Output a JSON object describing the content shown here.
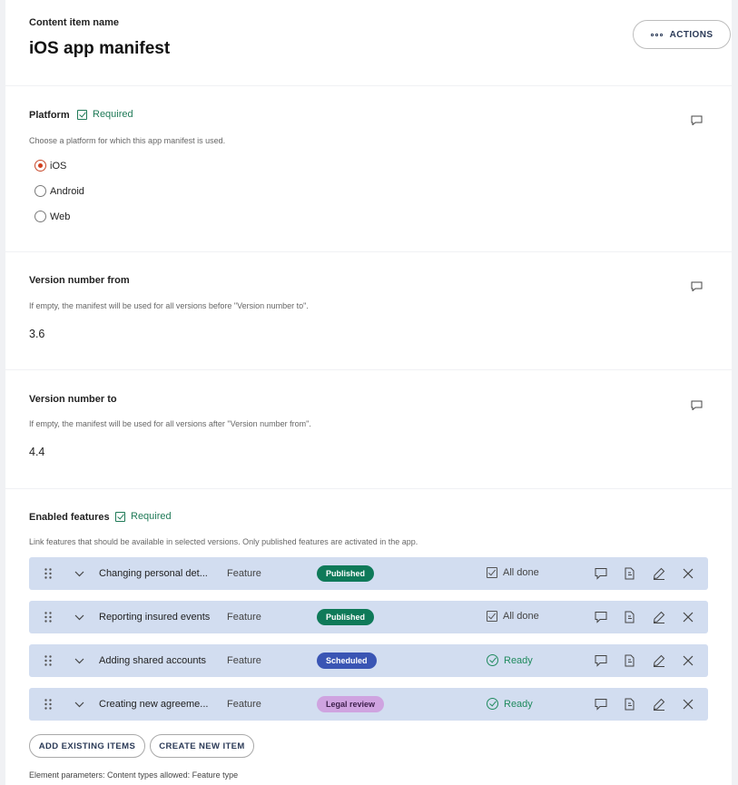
{
  "header": {
    "label": "Content item name",
    "title": "iOS app manifest",
    "actions_label": "ACTIONS"
  },
  "platform": {
    "label": "Platform",
    "required": "Required",
    "guidelines": "Choose a platform for which this app manifest is used.",
    "options": [
      {
        "label": "iOS",
        "selected": true
      },
      {
        "label": "Android",
        "selected": false
      },
      {
        "label": "Web",
        "selected": false
      }
    ]
  },
  "version_from": {
    "label": "Version number from",
    "guidelines": "If empty, the manifest will be used for all versions before \"Version number to\".",
    "value": "3.6"
  },
  "version_to": {
    "label": "Version number to",
    "guidelines": "If empty, the manifest will be used for all versions after \"Version number from\".",
    "value": "4.4"
  },
  "features": {
    "label": "Enabled features",
    "required": "Required",
    "guidelines": "Link features that should be available in selected versions. Only published features are activated in the app.",
    "items": [
      {
        "name": "Changing personal det...",
        "type": "Feature",
        "status": "Published",
        "status_color": "#0f7a59",
        "workflow": "All done",
        "workflow_kind": "done"
      },
      {
        "name": "Reporting insured events",
        "type": "Feature",
        "status": "Published",
        "status_color": "#0f7a59",
        "workflow": "All done",
        "workflow_kind": "done"
      },
      {
        "name": "Adding shared accounts",
        "type": "Feature",
        "status": "Scheduled",
        "status_color": "#3a55b4",
        "workflow": "Ready",
        "workflow_kind": "ready"
      },
      {
        "name": "Creating new agreeme...",
        "type": "Feature",
        "status": "Legal review",
        "status_color": "#cfa3e0",
        "workflow": "Ready",
        "workflow_kind": "ready"
      }
    ],
    "add_existing_label": "ADD EXISTING ITEMS",
    "create_new_label": "CREATE NEW ITEM",
    "parameters": "Element parameters: Content types allowed: Feature type"
  },
  "colors": {
    "accent_green": "#1f7a57",
    "radio_selected": "#d2401f",
    "item_background": "#d2ddf0"
  },
  "icons": {
    "comment": "comment-icon",
    "drag": "drag-handle-icon",
    "expand": "chevron-down-icon",
    "duplicate": "copy-icon",
    "edit": "pencil-icon",
    "remove": "close-icon"
  }
}
